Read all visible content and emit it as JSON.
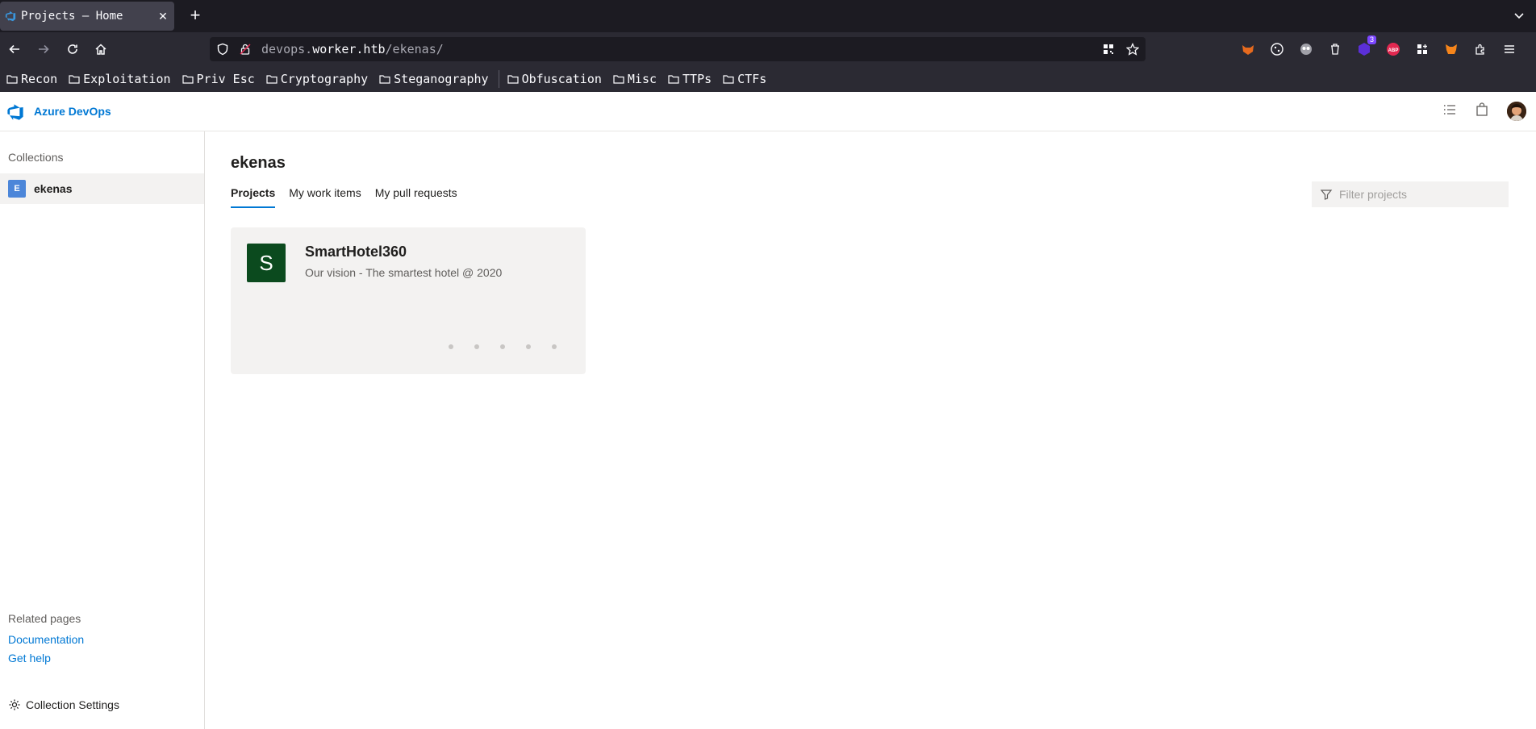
{
  "browser": {
    "tab_title": "Projects – Home",
    "url_prefix": "devops.",
    "url_domain": "worker.htb",
    "url_path": "/ekenas/",
    "ext_badge_count": "3",
    "ext_abp_label": "ABP",
    "bookmarks": [
      "Recon",
      "Exploitation",
      "Priv Esc",
      "Cryptography",
      "Steganography",
      "Obfuscation",
      "Misc",
      "TTPs",
      "CTFs"
    ]
  },
  "app": {
    "product_name": "Azure DevOps",
    "brand_color": "#0078d4"
  },
  "sidebar": {
    "collections_label": "Collections",
    "collection": {
      "badge": "E",
      "name": "ekenas"
    },
    "related_label": "Related pages",
    "links": [
      "Documentation",
      "Get help"
    ],
    "settings_label": "Collection Settings"
  },
  "main": {
    "title": "ekenas",
    "tabs": [
      {
        "label": "Projects",
        "active": true
      },
      {
        "label": "My work items",
        "active": false
      },
      {
        "label": "My pull requests",
        "active": false
      }
    ],
    "filter_placeholder": "Filter projects",
    "projects": [
      {
        "initial": "S",
        "name": "SmartHotel360",
        "description": "Our vision - The smartest hotel @ 2020",
        "avatar_color": "#0b4a1e"
      }
    ]
  }
}
